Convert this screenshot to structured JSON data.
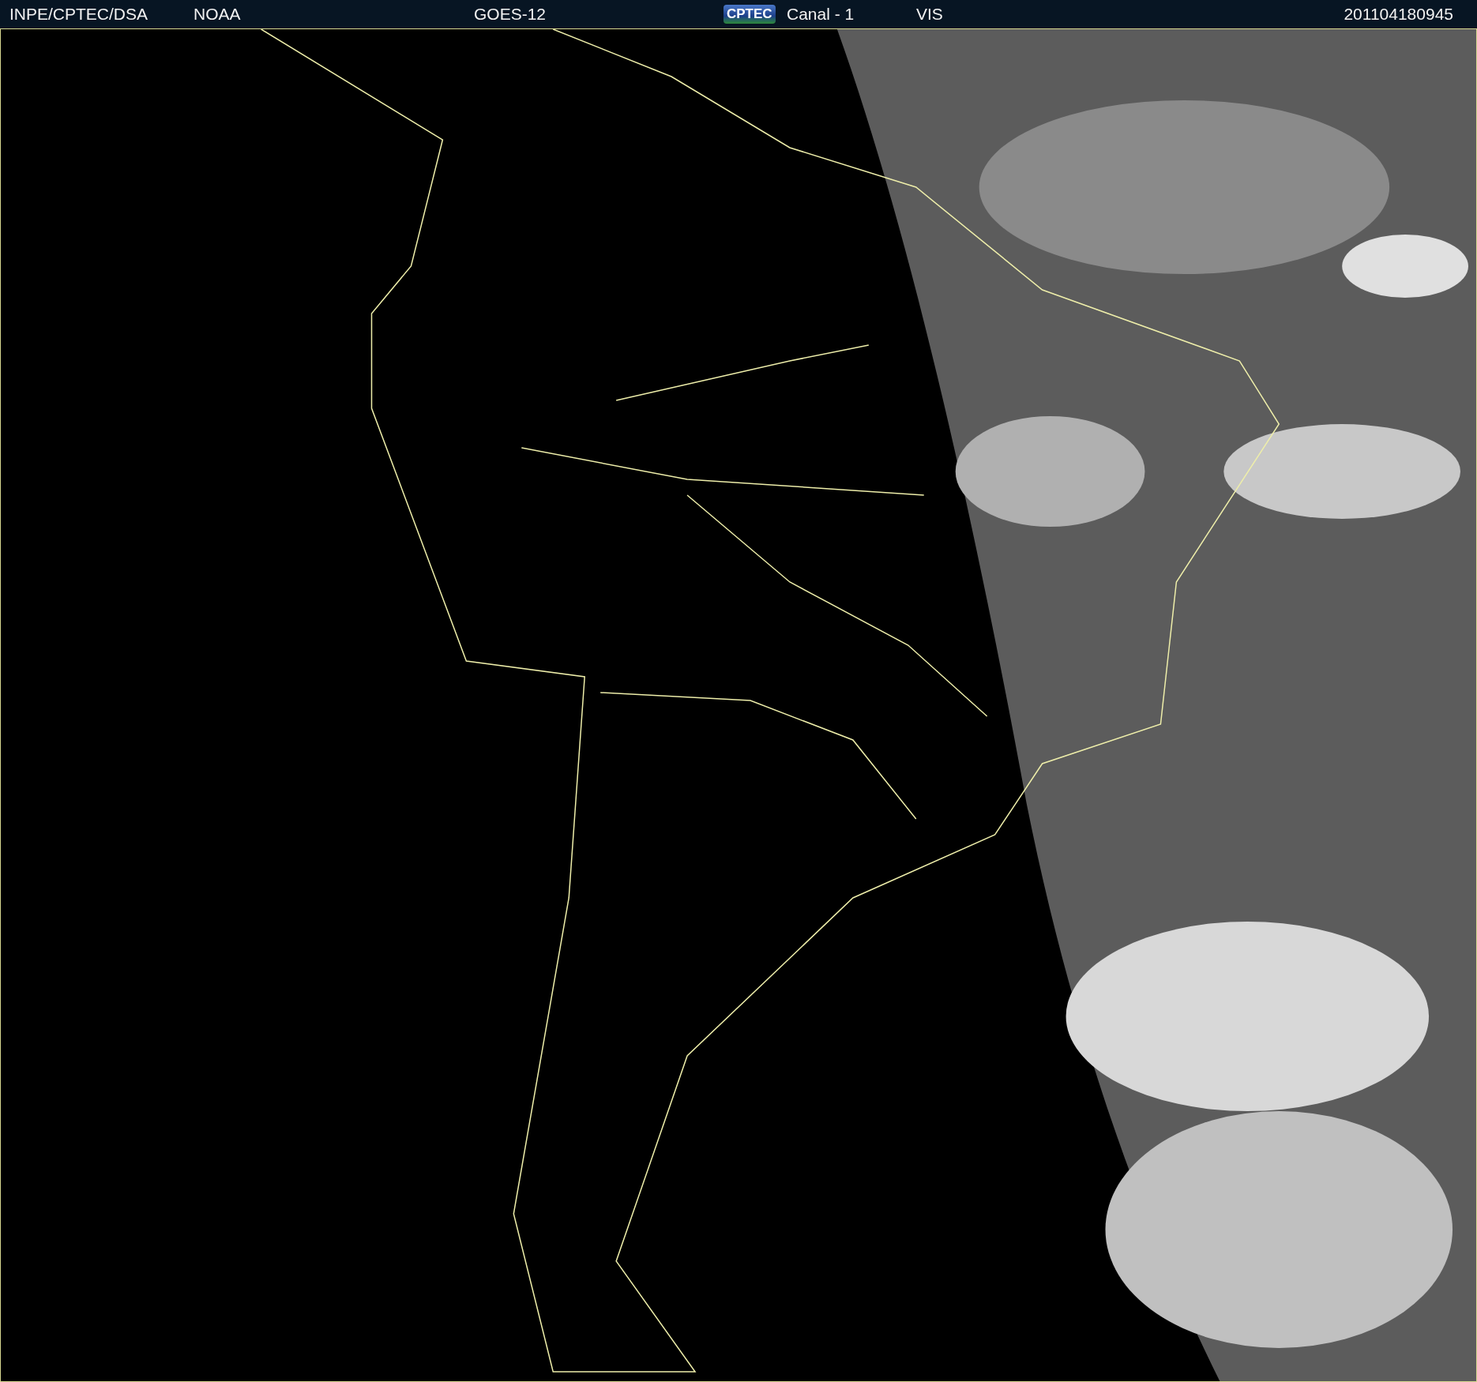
{
  "header": {
    "source": "INPE/CPTEC/DSA",
    "agency": "NOAA",
    "satellite": "GOES-12",
    "logo": "CPTEC",
    "channel": "Canal - 1",
    "band": "VIS",
    "timestamp": "201104180945"
  }
}
